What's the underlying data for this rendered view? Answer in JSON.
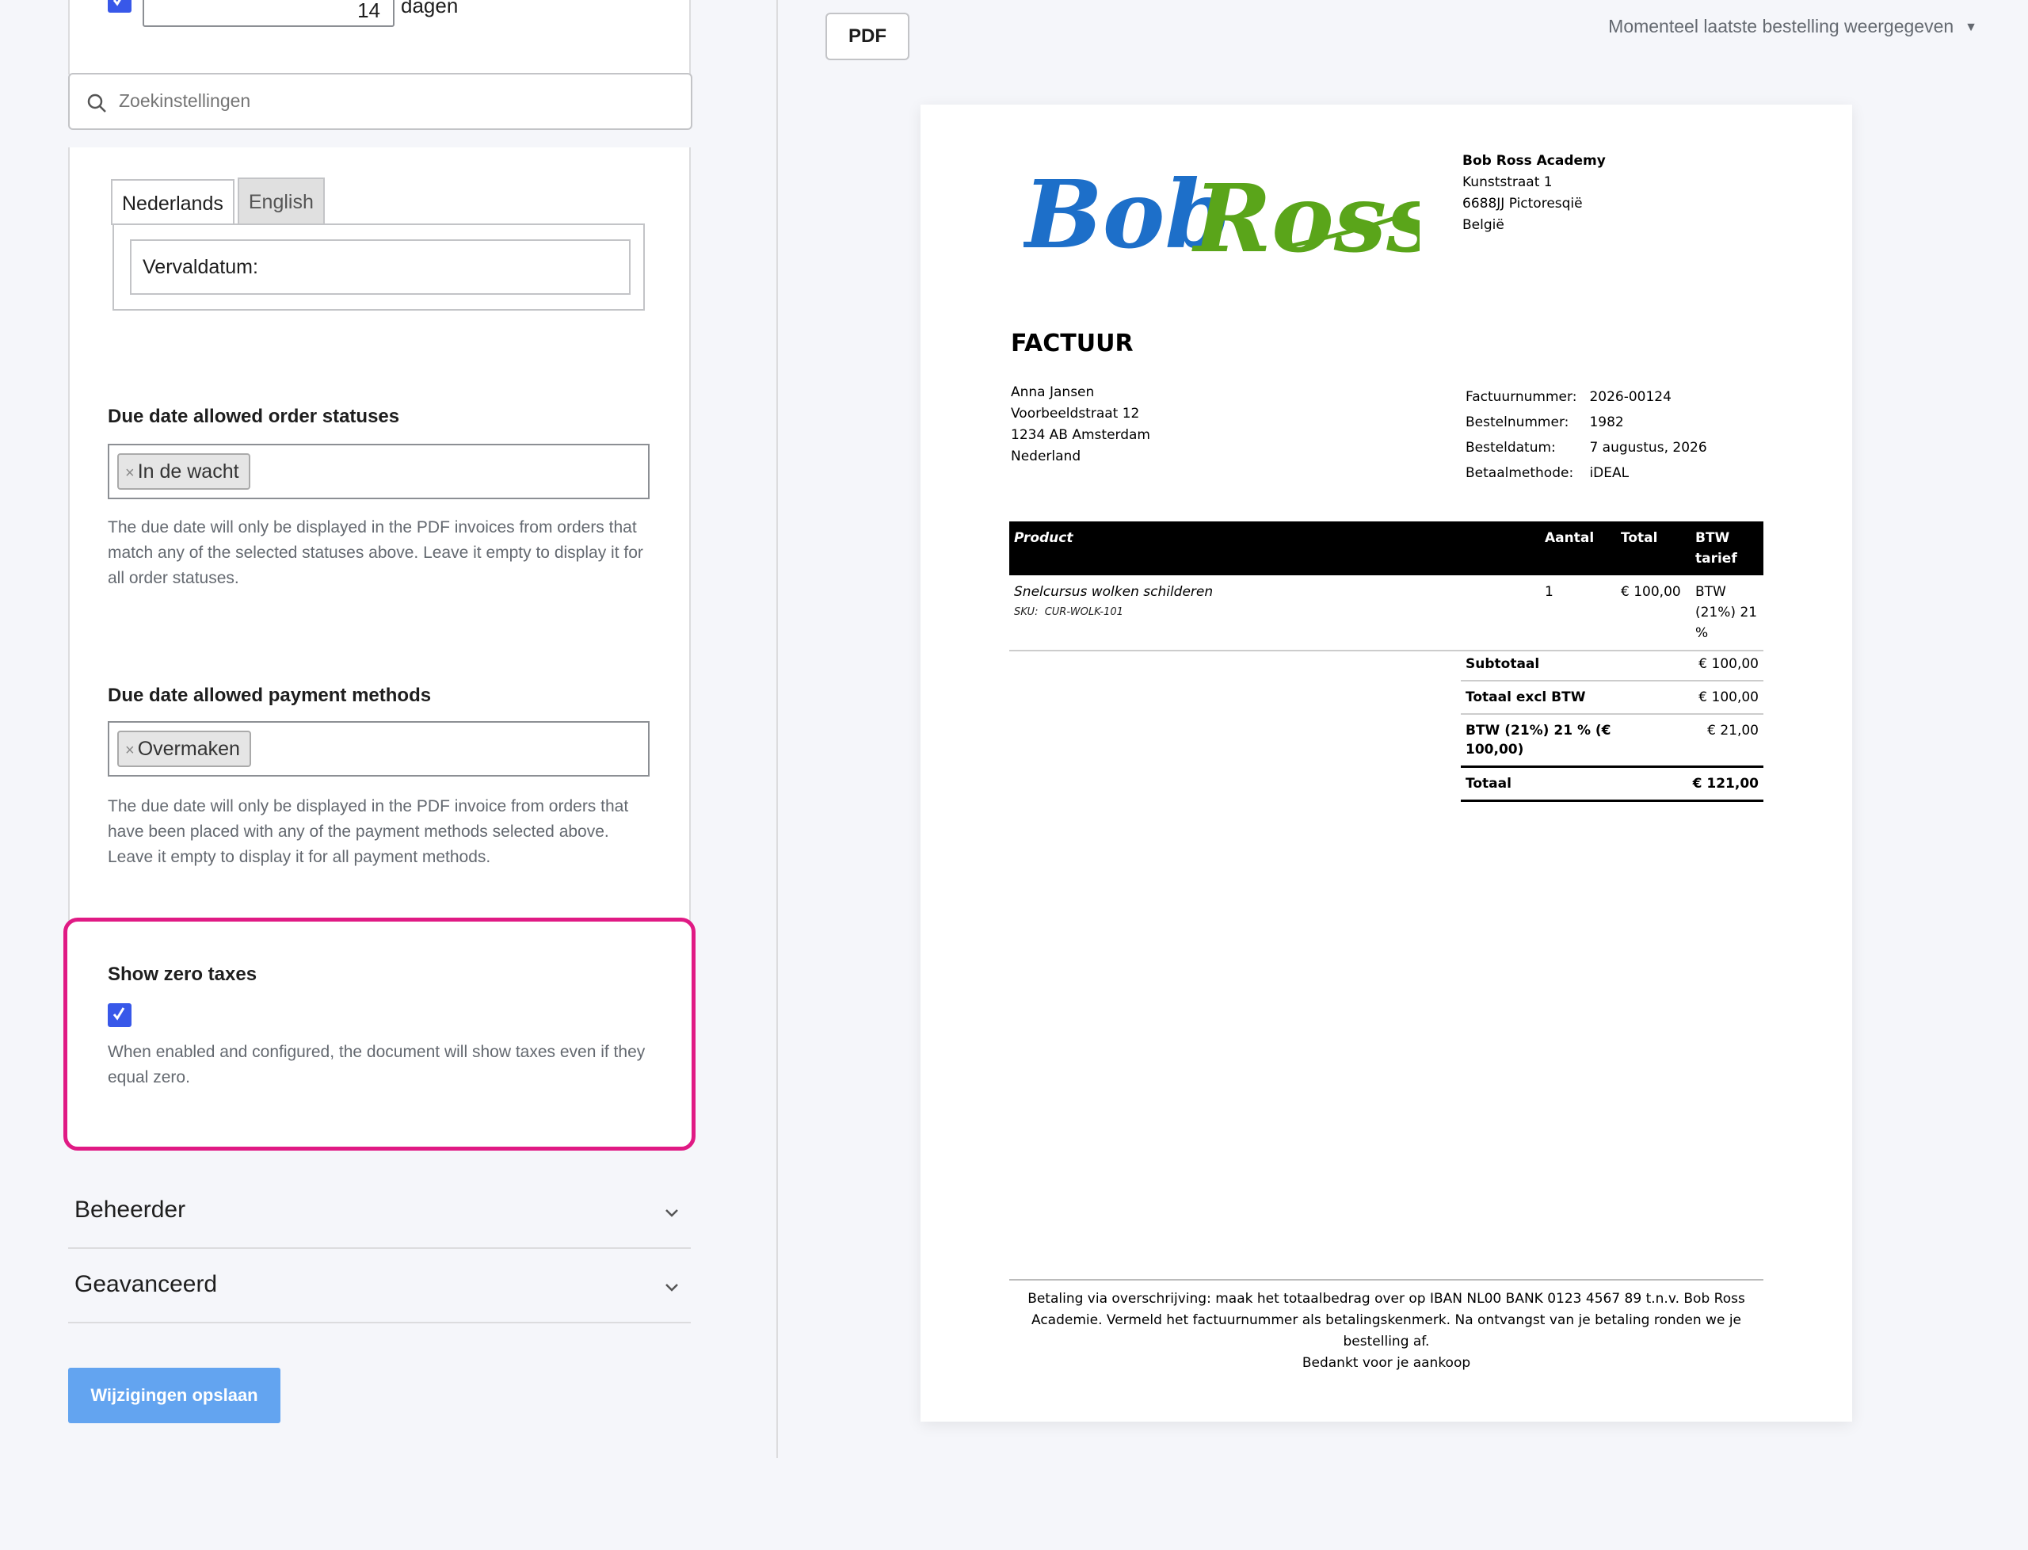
{
  "settings": {
    "due_days": {
      "value": "14",
      "suffix": "dagen"
    },
    "search": {
      "placeholder": "Zoekinstellingen"
    },
    "language_tabs": [
      {
        "label": "Nederlands",
        "active": true
      },
      {
        "label": "English",
        "active": false
      }
    ],
    "due_date_label_value": "Vervaldatum:",
    "order_statuses": {
      "label": "Due date allowed order statuses",
      "tags": [
        "In de wacht"
      ],
      "help": "The due date will only be displayed in the PDF invoices from orders that match any of the selected statuses above. Leave it empty to display it for all order statuses."
    },
    "payment_methods": {
      "label": "Due date allowed payment methods",
      "tags": [
        "Overmaken"
      ],
      "help": "The due date will only be displayed in the PDF invoice from orders that have been placed with any of the payment methods selected above. Leave it empty to display it for all payment methods."
    },
    "zero_taxes": {
      "label": "Show zero taxes",
      "checked": true,
      "help": "When enabled and configured, the document will show taxes even if they equal zero."
    },
    "accordions": [
      {
        "label": "Beheerder"
      },
      {
        "label": "Geavanceerd"
      }
    ],
    "save_label": "Wijzigingen opslaan",
    "tag_remove_glyph": "×"
  },
  "preview": {
    "pdf_button": "PDF",
    "order_select": "Momenteel laatste bestelling weergegeven",
    "invoice": {
      "logo_text_1": "Bob",
      "logo_text_2": "Ross",
      "shop": {
        "name": "Bob Ross Academy",
        "street": "Kunststraat 1",
        "city": "6688JJ Pictoresqië",
        "country": "België"
      },
      "title": "FACTUUR",
      "billing": {
        "name": "Anna Jansen",
        "street": "Voorbeeldstraat 12",
        "city": "1234 AB Amsterdam",
        "country": "Nederland"
      },
      "meta": [
        {
          "label": "Factuurnummer:",
          "value": "2026-00124"
        },
        {
          "label": "Bestelnummer:",
          "value": "1982"
        },
        {
          "label": "Besteldatum:",
          "value": "7 augustus, 2026"
        },
        {
          "label": "Betaalmethode:",
          "value": "iDEAL"
        }
      ],
      "columns": {
        "product": "Product",
        "quantity": "Aantal",
        "total": "Total",
        "tax": "BTW tarief"
      },
      "item": {
        "name": "Snelcursus wolken schilderen",
        "sku_label": "SKU:",
        "sku": "CUR-WOLK-101",
        "quantity": "1",
        "total": "€ 100,00",
        "tax": "BTW (21%) 21 %"
      },
      "totals": [
        {
          "label": "Subtotaal",
          "value": "€ 100,00"
        },
        {
          "label": "Totaal excl BTW",
          "value": "€ 100,00"
        },
        {
          "label": "BTW (21%) 21 % (€ 100,00)",
          "value": "€ 21,00"
        }
      ],
      "grand_total": {
        "label": "Totaal",
        "value": "€ 121,00"
      },
      "footer_note": "Betaling via overschrijving: maak het totaalbedrag over op IBAN NL00 BANK 0123 4567 89 t.n.v. Bob Ross Academie. Vermeld het factuurnummer als betalingskenmerk. Na ontvangst van je betaling ronden we je bestelling af.",
      "footer_thanks": "Bedankt voor je aankoop"
    }
  },
  "colors": {
    "accent_blue": "#3858e9",
    "highlight_pink": "#e01a84",
    "save_button": "#63a4f0",
    "logo_blue": "#1d6fc9",
    "logo_green": "#5aa51a"
  }
}
